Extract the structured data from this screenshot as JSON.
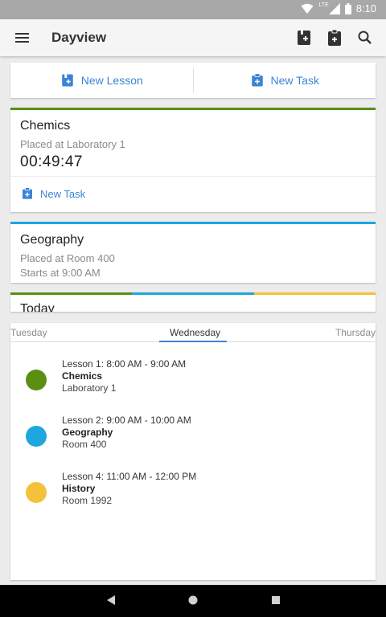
{
  "status": {
    "time": "8:10",
    "network": "LTE"
  },
  "appbar": {
    "title": "Dayview"
  },
  "actions": {
    "new_lesson": "New Lesson",
    "new_task": "New Task"
  },
  "current": {
    "name": "Chemics",
    "place": "Placed at Laboratory 1",
    "timer": "00:49:47",
    "new_task": "New Task",
    "color": "#5a8f14"
  },
  "next": {
    "name": "Geography",
    "place": "Placed at Room 400",
    "starts": "Starts at 9:00 AM",
    "color": "#1ea6de"
  },
  "today": {
    "label": "Today",
    "colors": [
      "#5a8f14",
      "#1ea6de",
      "#f4c23a"
    ]
  },
  "tabs": {
    "prev": "Tuesday",
    "active": "Wednesday",
    "next": "Thursday"
  },
  "lessons": [
    {
      "time": "Lesson 1: 8:00 AM - 9:00 AM",
      "name": "Chemics",
      "room": "Laboratory 1",
      "color": "#5a8f14"
    },
    {
      "time": "Lesson 2: 9:00 AM - 10:00 AM",
      "name": "Geography",
      "room": "Room 400",
      "color": "#1ea6de"
    },
    {
      "time": "Lesson 4: 11:00 AM - 12:00 PM",
      "name": "History",
      "room": "Room 1992",
      "color": "#f4c23a"
    }
  ],
  "icons": {
    "menu": "menu-icon",
    "add_lesson": "add-lesson-icon",
    "add_task": "add-task-icon",
    "search": "search-icon",
    "back": "back-icon",
    "home": "home-icon",
    "recents": "recents-icon"
  }
}
